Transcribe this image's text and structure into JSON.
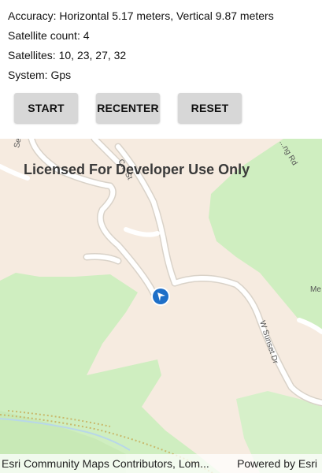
{
  "status": {
    "accuracy": "Accuracy: Horizontal 5.17 meters, Vertical  9.87 meters",
    "satellite_count": "Satellite count: 4",
    "satellites": "Satellites: 10, 23, 27, 32",
    "system": "System: Gps"
  },
  "buttons": {
    "start": "START",
    "recenter": "RECENTER",
    "reset": "RESET"
  },
  "map": {
    "watermark": "Licensed For Developer Use Only",
    "road_labels": {
      "serpentine": "Serpentine Dr",
      "cs": "C... St",
      "road_top_right": "...ng Rd",
      "sunset": "W Sunset Dr",
      "me": "Me"
    },
    "attribution_left": "Esri Community Maps Contributors, Lom...",
    "attribution_right": "Powered by Esri",
    "colors": {
      "land": "#f6ebe0",
      "green": "#cfeec0",
      "road": "#ffffff",
      "marker": "#1e6fc8"
    }
  }
}
